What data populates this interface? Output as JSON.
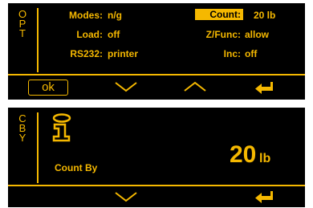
{
  "opt_panel": {
    "mode_letters": [
      "O",
      "P",
      "T"
    ],
    "rows": [
      {
        "label": "Modes:",
        "value": "n/g"
      },
      {
        "label": "Load:",
        "value": "off"
      },
      {
        "label": "RS232:",
        "value": "printer"
      }
    ],
    "rows_right": [
      {
        "label": "Count:",
        "value": "20 lb",
        "highlighted": true
      },
      {
        "label": "Z/Func:",
        "value": "allow"
      },
      {
        "label": "Inc:",
        "value": "off"
      }
    ],
    "softkeys": {
      "ok_label": "ok",
      "icons": [
        "chevron-down-icon",
        "chevron-up-icon",
        "enter-arrow-icon"
      ]
    }
  },
  "cby_panel": {
    "mode_letters": [
      "C",
      "B",
      "Y"
    ],
    "info_icon": "info-icon",
    "title": "Count By",
    "value_number": "20",
    "value_unit": "lb",
    "softkeys": {
      "icons": [
        "chevron-down-icon",
        "enter-arrow-icon"
      ]
    }
  },
  "colors": {
    "background": "#000000",
    "accent": "#f5b800"
  }
}
